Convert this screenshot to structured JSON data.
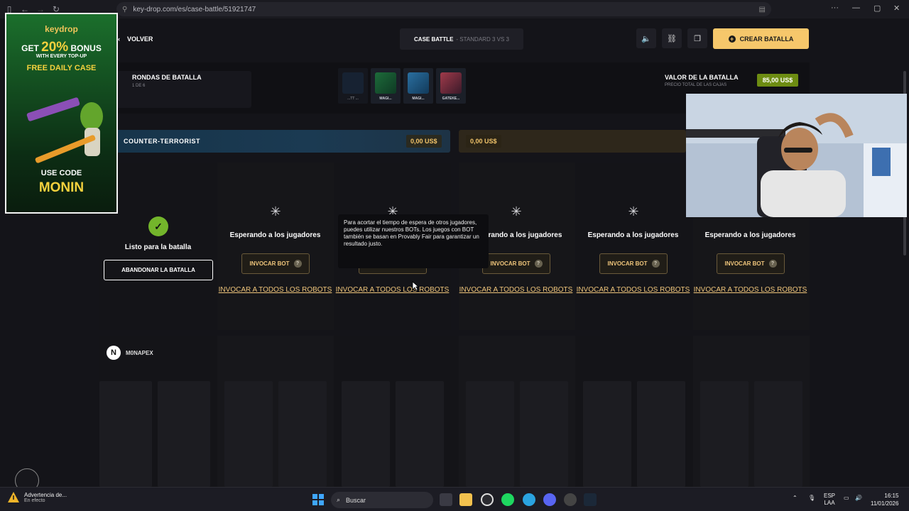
{
  "browser": {
    "url": "key-drop.com/es/case-battle/51921747"
  },
  "topbar": {
    "back_label": "VOLVER",
    "mode_title": "CASE BATTLE",
    "mode_sub": "- STANDARD 3 VS 3",
    "create_label": "CREAR BATALLA"
  },
  "rounds": {
    "title": "RONDAS DE BATALLA",
    "sub": "1 DE 6",
    "cases": [
      {
        "label": "...TT ..."
      },
      {
        "label": "MAGI..."
      },
      {
        "label": "MAGI..."
      },
      {
        "label": "GATEKE..."
      }
    ]
  },
  "value": {
    "title": "VALOR DE LA BATALLA",
    "sub": "PRECIO TOTAL DE LAS CAJAS",
    "amount": "85,00 US$"
  },
  "teams": {
    "ct_name": "COUNTER-TERRORIST",
    "ct_amount": "0,00 US$",
    "t_amount": "0,00 US$"
  },
  "slots": {
    "ready_text": "Listo para la batalla",
    "abandon_label": "ABANDONAR LA BATALLA",
    "wait_text": "Esperando a los jugadores",
    "bot_label": "INVOCAR BOT",
    "bot_help": "?",
    "all_bots_label": "INVOCAR A TODOS LOS ROBOTS",
    "tooltip": "Para acortar el tiempo de espera de otros jugadores, puedes utilizar nuestros BOTs. Los juegos con BOT también se basan en Provably Fair para garantizar un resultado justo."
  },
  "player": {
    "avatar_letter": "N",
    "name": "M0NAPEX"
  },
  "ad": {
    "logo": "keydrop",
    "get": "GET",
    "percent": "20%",
    "bonus": "BONUS",
    "with_every": "WITH EVERY TOP-UP",
    "free_case": "FREE DAILY CASE",
    "use_code": "USE CODE",
    "code": "MONIN"
  },
  "taskbar": {
    "weather_title": "Advertencia de...",
    "weather_sub": "En efecto",
    "search_label": "Buscar",
    "lang_top": "ESP",
    "lang_bottom": "LAA",
    "time": "16:15",
    "date": "11/01/2026"
  },
  "colors": {
    "accent": "#f6c76b",
    "value_green": "#6d8c12",
    "ready_green": "#73b52b",
    "ct_blue": "#1b3a52"
  }
}
